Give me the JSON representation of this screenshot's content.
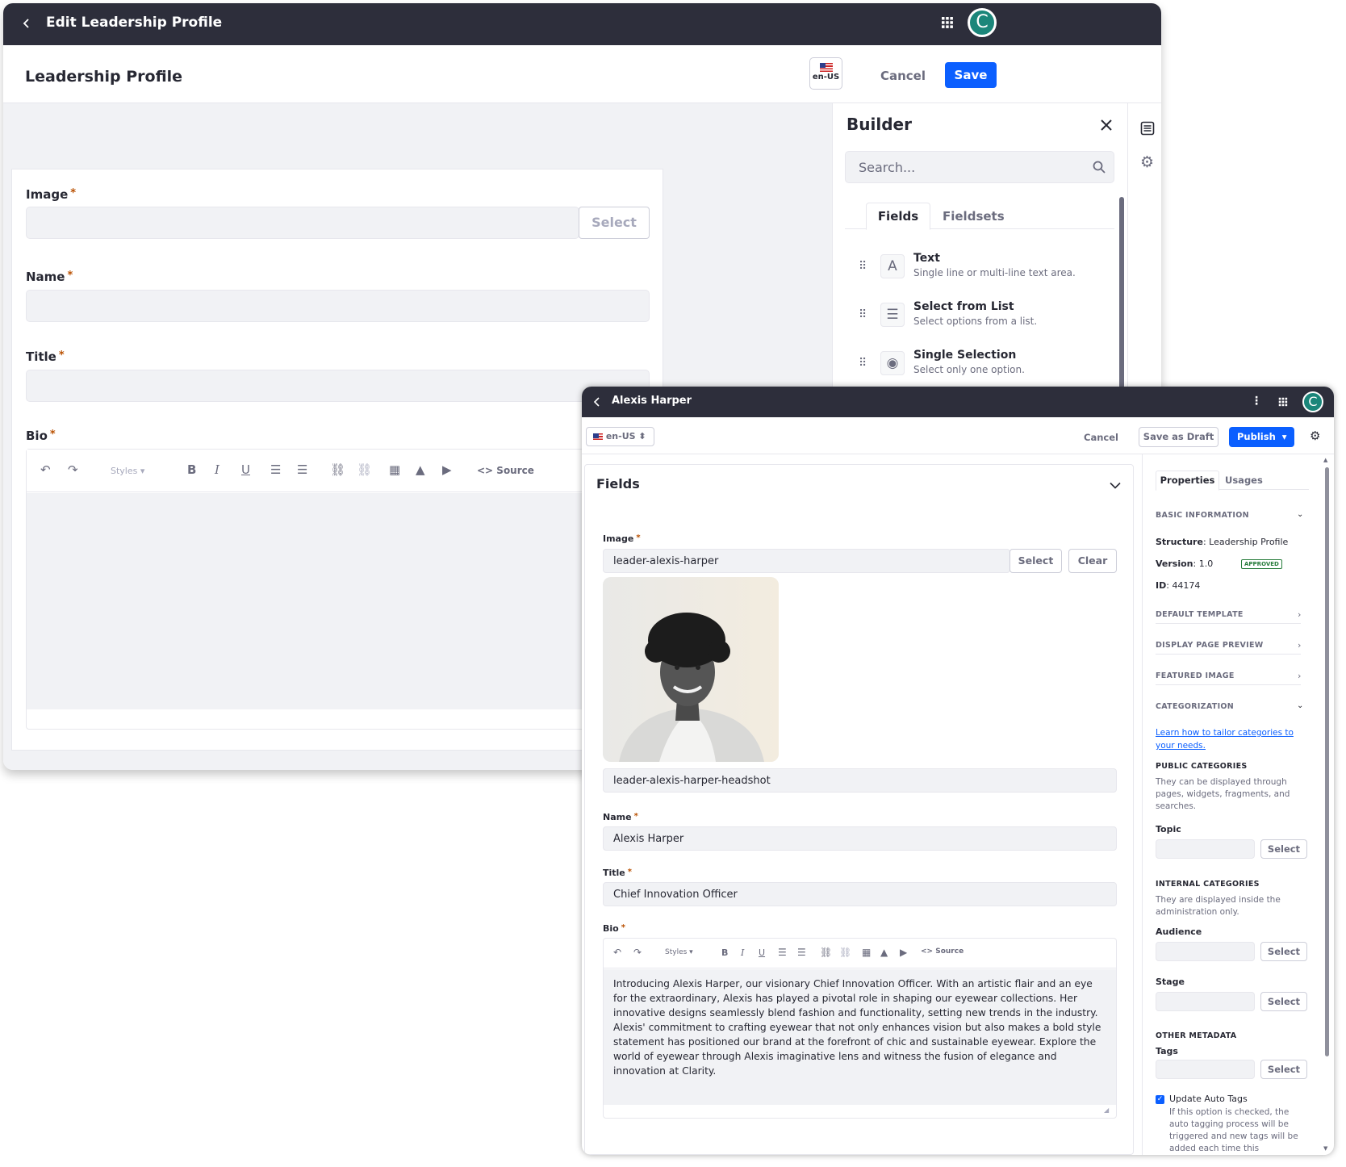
{
  "back_window": {
    "title": "Edit Leadership Profile",
    "page_title": "Leadership Profile",
    "locale": "en-US",
    "cancel_label": "Cancel",
    "save_label": "Save",
    "form": {
      "image_label": "Image",
      "image_select": "Select",
      "name_label": "Name",
      "title_label": "Title",
      "bio_label": "Bio",
      "styles_label": "Styles",
      "source_label": "Source",
      "required_mark": "*"
    },
    "builder": {
      "title": "Builder",
      "search_placeholder": "Search...",
      "tabs": [
        "Fields",
        "Fieldsets"
      ],
      "fields": [
        {
          "name": "Text",
          "desc": "Single line or multi-line text area.",
          "icon": "text-icon"
        },
        {
          "name": "Select from List",
          "desc": "Select options from a list.",
          "icon": "list-icon"
        },
        {
          "name": "Single Selection",
          "desc": "Select only one option.",
          "icon": "radio-icon"
        }
      ]
    }
  },
  "front_window": {
    "title": "Alexis Harper",
    "locale": "en-US",
    "cancel_label": "Cancel",
    "save_draft_label": "Save as Draft",
    "publish_label": "Publish",
    "fields_title": "Fields",
    "image_label": "Image",
    "image_value": "leader-alexis-harper",
    "select_label": "Select",
    "clear_label": "Clear",
    "image_caption": "leader-alexis-harper-headshot",
    "name_label": "Name",
    "name_value": "Alexis Harper",
    "title_label": "Title",
    "title_value": "Chief Innovation Officer",
    "bio_label": "Bio",
    "styles_label": "Styles",
    "source_label": "Source",
    "bio_text": "Introducing Alexis Harper, our visionary Chief Innovation Officer. With an artistic flair and an eye for the extraordinary, Alexis has played a pivotal role in shaping our eyewear collections. Her innovative designs seamlessly blend fashion and functionality, setting new trends in the industry. Alexis' commitment to crafting eyewear that not only enhances vision but also makes a bold style statement has positioned our brand at the forefront of chic and sustainable eyewear. Explore the world of eyewear through Alexis imaginative lens and witness the fusion of elegance and innovation at Clarity.",
    "required_mark": "*",
    "sidebar": {
      "tabs": [
        "Properties",
        "Usages"
      ],
      "basic_information": "BASIC INFORMATION",
      "structure_key": "Structure",
      "structure_value": "Leadership Profile",
      "version_key": "Version",
      "version_value": "1.0",
      "status_badge": "APPROVED",
      "id_key": "ID",
      "id_value": "44174",
      "default_template": "DEFAULT TEMPLATE",
      "display_page_preview": "DISPLAY PAGE PREVIEW",
      "featured_image": "FEATURED IMAGE",
      "categorization": "CATEGORIZATION",
      "learn_link": "Learn how to tailor categories to your needs.",
      "public_categories": "PUBLIC CATEGORIES",
      "public_desc": "They can be displayed through pages, widgets, fragments, and searches.",
      "topic_label": "Topic",
      "internal_categories": "INTERNAL CATEGORIES",
      "internal_desc": "They are displayed inside the administration only.",
      "audience_label": "Audience",
      "stage_label": "Stage",
      "other_metadata": "OTHER METADATA",
      "tags_label": "Tags",
      "select_label": "Select",
      "auto_tags_label": "Update Auto Tags",
      "auto_tags_desc": "If this option is checked, the auto tagging process will be triggered and new tags will be added each time this document"
    }
  },
  "colors": {
    "topbar": "#2d2e3b",
    "primary": "#0b5fff",
    "avatar": "#1b867a",
    "required": "#b95000",
    "approved": "#287d3c"
  }
}
